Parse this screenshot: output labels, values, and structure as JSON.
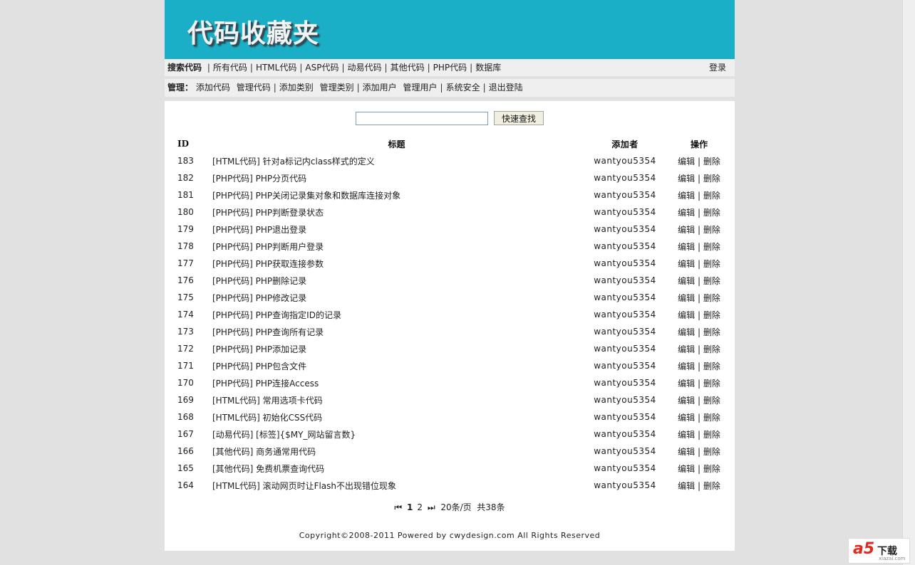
{
  "header": {
    "logo_text": "代码收藏夹"
  },
  "nav": {
    "search_label": "搜索代码",
    "items": [
      "所有代码",
      "HTML代码",
      "ASP代码",
      "动易代码",
      "其他代码",
      "PHP代码",
      "数据库"
    ],
    "login": "登录"
  },
  "admin": {
    "label": "管理：",
    "items": [
      "添加代码",
      "管理代码",
      "添加类别",
      "管理类别",
      "添加用户",
      "管理用户",
      "系统安全",
      "退出登陆"
    ]
  },
  "search": {
    "value": "",
    "button": "快速查找"
  },
  "table": {
    "headers": {
      "id": "ID",
      "title": "标题",
      "user": "添加者",
      "op": "操作"
    },
    "edit_label": "编辑",
    "delete_label": "删除",
    "rows": [
      {
        "id": "183",
        "title": "[HTML代码] 针对a标记内class样式的定义",
        "user": "wantyou5354"
      },
      {
        "id": "182",
        "title": "[PHP代码] PHP分页代码",
        "user": "wantyou5354"
      },
      {
        "id": "181",
        "title": "[PHP代码] PHP关闭记录集对象和数据库连接对象",
        "user": "wantyou5354"
      },
      {
        "id": "180",
        "title": "[PHP代码] PHP判断登录状态",
        "user": "wantyou5354"
      },
      {
        "id": "179",
        "title": "[PHP代码] PHP退出登录",
        "user": "wantyou5354"
      },
      {
        "id": "178",
        "title": "[PHP代码] PHP判断用户登录",
        "user": "wantyou5354"
      },
      {
        "id": "177",
        "title": "[PHP代码] PHP获取连接参数",
        "user": "wantyou5354"
      },
      {
        "id": "176",
        "title": "[PHP代码] PHP删除记录",
        "user": "wantyou5354"
      },
      {
        "id": "175",
        "title": "[PHP代码] PHP修改记录",
        "user": "wantyou5354"
      },
      {
        "id": "174",
        "title": "[PHP代码] PHP查询指定ID的记录",
        "user": "wantyou5354"
      },
      {
        "id": "173",
        "title": "[PHP代码] PHP查询所有记录",
        "user": "wantyou5354"
      },
      {
        "id": "172",
        "title": "[PHP代码] PHP添加记录",
        "user": "wantyou5354"
      },
      {
        "id": "171",
        "title": "[PHP代码] PHP包含文件",
        "user": "wantyou5354"
      },
      {
        "id": "170",
        "title": "[PHP代码] PHP连接Access",
        "user": "wantyou5354"
      },
      {
        "id": "169",
        "title": "[HTML代码] 常用选项卡代码",
        "user": "wantyou5354"
      },
      {
        "id": "168",
        "title": "[HTML代码] 初始化CSS代码",
        "user": "wantyou5354"
      },
      {
        "id": "167",
        "title": "[动易代码] [标签]{$MY_网站留言数}",
        "user": "wantyou5354"
      },
      {
        "id": "166",
        "title": "[其他代码] 商务通常用代码",
        "user": "wantyou5354"
      },
      {
        "id": "165",
        "title": "[其他代码] 免费机票查询代码",
        "user": "wantyou5354"
      },
      {
        "id": "164",
        "title": "[HTML代码] 滚动网页时让Flash不出现错位现象",
        "user": "wantyou5354"
      }
    ]
  },
  "pager": {
    "first_icon": "⏮",
    "pages": [
      "1",
      "2"
    ],
    "current": "1",
    "last_icon": "⏭",
    "per_page": "20条/页",
    "total": "共38条"
  },
  "footer": {
    "text": "Copyright©2008-2011 Powered by cwydesign.com All Rights Reserved"
  },
  "watermark": {
    "brand": "a5",
    "label": "下载",
    "url": "xiazai.com"
  }
}
